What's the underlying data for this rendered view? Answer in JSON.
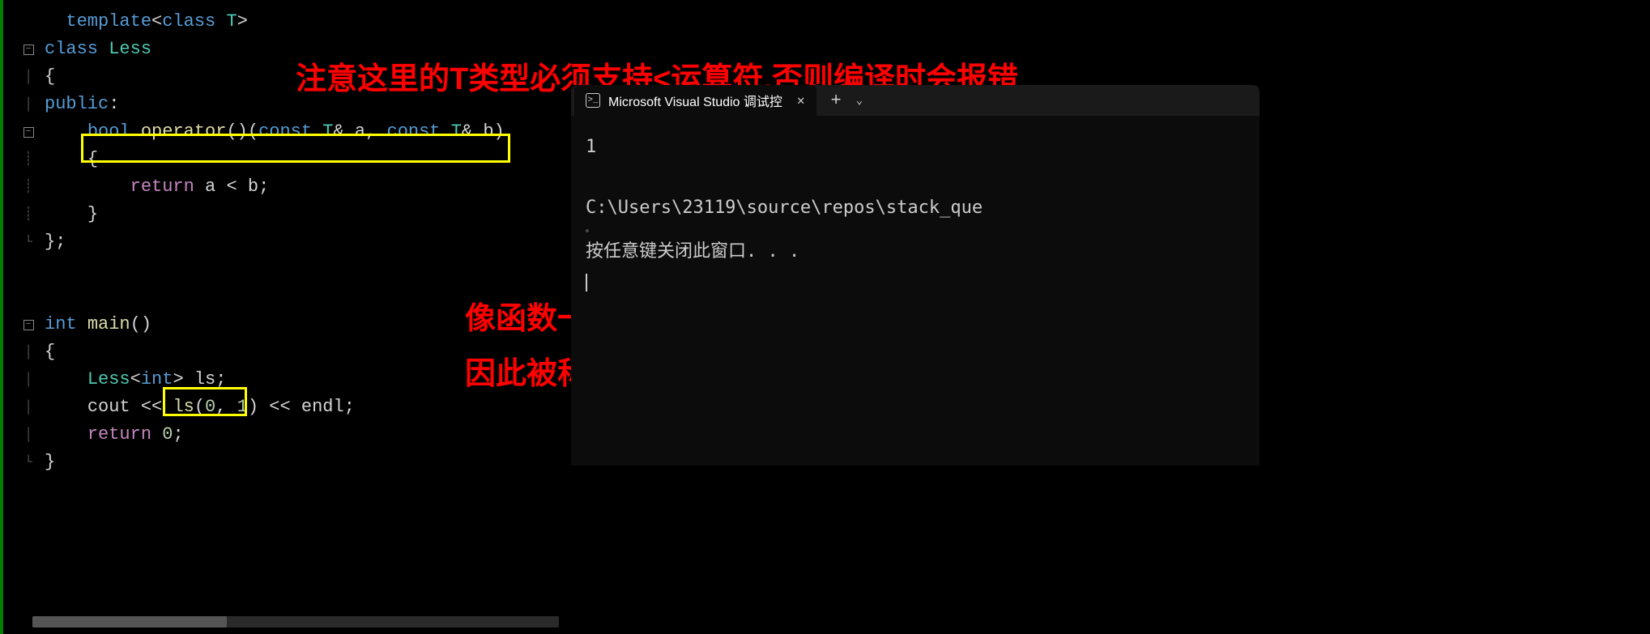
{
  "annotations": {
    "top": "注意这里的T类型必须支持<运算符,否则编译时会报错",
    "mid_line1": "像函数一样来使用",
    "mid_line2": "因此被称为仿函数"
  },
  "code": {
    "l1_template": "template",
    "l1_class": "class",
    "l1_T": "T",
    "l2_class": "class",
    "l2_Less": "Less",
    "l4_public": "public",
    "l5_bool": "bool",
    "l5_operator": "operator",
    "l5_const": "const",
    "l5_T": "T",
    "l5_a": "a",
    "l5_b": "b",
    "l7_return": "return",
    "l7_expr_a": "a",
    "l7_expr_b": "b",
    "l11_int": "int",
    "l11_main": "main",
    "l13_Less": "Less",
    "l13_int": "int",
    "l13_ls": "ls",
    "l14_cout": "cout",
    "l14_ls": "ls",
    "l14_arg0": "0",
    "l14_arg1": "1",
    "l14_endl": "endl",
    "l15_return": "return",
    "l15_zero": "0"
  },
  "console": {
    "tab_title": "Microsoft Visual Studio 调试控",
    "output_1": "1",
    "output_path": "C:\\Users\\23119\\source\\repos\\stack_que",
    "output_dot": "。",
    "output_prompt": "按任意键关闭此窗口. . ."
  }
}
